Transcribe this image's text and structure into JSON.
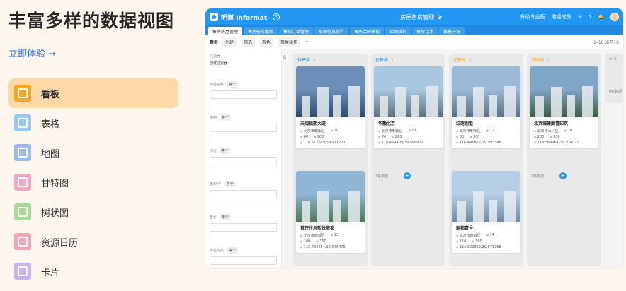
{
  "hero": {
    "title": "丰富多样的数据视图",
    "try_link": "立即体验 →"
  },
  "views": [
    {
      "label": "看板",
      "icon": "kanban-icon",
      "color": "#f5a623",
      "active": true
    },
    {
      "label": "表格",
      "icon": "table-icon",
      "color": "#74b9f5",
      "active": false
    },
    {
      "label": "地图",
      "icon": "map-icon",
      "color": "#7aa7f2",
      "active": false
    },
    {
      "label": "甘特图",
      "icon": "gantt-icon",
      "color": "#f28cb3",
      "active": false
    },
    {
      "label": "树状图",
      "icon": "tree-icon",
      "color": "#8bd47a",
      "active": false
    },
    {
      "label": "资源日历",
      "icon": "calendar-icon",
      "color": "#f08aa5",
      "active": false
    },
    {
      "label": "卡片",
      "icon": "card-icon",
      "color": "#b99cf0",
      "active": false
    }
  ],
  "app": {
    "brand": "明道 Informat",
    "center_title": "房屋售房管理",
    "right": [
      "升级专业版",
      "邀请成员"
    ],
    "tabs": [
      "售房房屋管理",
      "售房任务跟踪",
      "售房订单管理",
      "房源信息资料",
      "售房合同模板",
      "公司资料",
      "售房话术",
      "数据分析"
    ],
    "toolbar": {
      "view": "看板",
      "create": "创建",
      "filter": "筛选",
      "color": "着色",
      "batch": "批量操作",
      "pager": "1–10 当前10"
    },
    "filter": {
      "title": "过滤器",
      "add": "创建过滤器",
      "fields": [
        {
          "name": "房屋名称",
          "op": "等于"
        },
        {
          "name": "面积",
          "op": "等于"
        },
        {
          "name": "房价",
          "op": "等于"
        },
        {
          "name": "面积/平",
          "op": "等于"
        },
        {
          "name": "售价",
          "op": "等于"
        },
        {
          "name": "房屋分类",
          "op": "等于"
        },
        {
          "name": "房屋状态",
          "op": "等于"
        }
      ]
    },
    "columns": [
      {
        "title": "待售中",
        "count": "2",
        "color": "#2196f3",
        "cards": [
          {
            "name": "天润福熙大道",
            "district": "北京市朝阳区",
            "floor": "10",
            "a": "60",
            "b": "200",
            "coord": "116.512679,39.971277"
          },
          {
            "name": "首开住总熙悦安都",
            "district": "北京市西城区",
            "floor": "13",
            "a": "100",
            "b": "350",
            "coord": "116.433644,39.946476"
          }
        ],
        "foot": ""
      },
      {
        "title": "在售中",
        "count": "1",
        "color": "#2196f3",
        "cards": [
          {
            "name": "华融北京",
            "district": "北京市朝阳区",
            "floor": "11",
            "a": "70",
            "b": "260",
            "coord": "116.469409,39.998921"
          }
        ],
        "foot": "1条数据"
      },
      {
        "title": "已售出",
        "count": "2",
        "color": "#f5a623",
        "cards": [
          {
            "name": "红莲别墅",
            "district": "北京市朝阳区",
            "floor": "12",
            "a": "80",
            "b": "300",
            "coord": "116.496822,39.993348"
          },
          {
            "name": "丽都壹号",
            "district": "北京市西城区",
            "floor": "14",
            "a": "110",
            "b": "380",
            "coord": "116.502992,39.971768"
          }
        ],
        "foot": ""
      },
      {
        "title": "已取消",
        "count": "1",
        "color": "#f5a623",
        "cards": [
          {
            "name": "北京城建朗青知筑",
            "district": "北京市大兴区",
            "floor": "19",
            "a": "200",
            "b": "500",
            "coord": "116.569961,39.924021"
          }
        ],
        "foot": "1条数据"
      }
    ],
    "extra_col": {
      "title": "+ 0",
      "foot": "0条数据"
    }
  }
}
